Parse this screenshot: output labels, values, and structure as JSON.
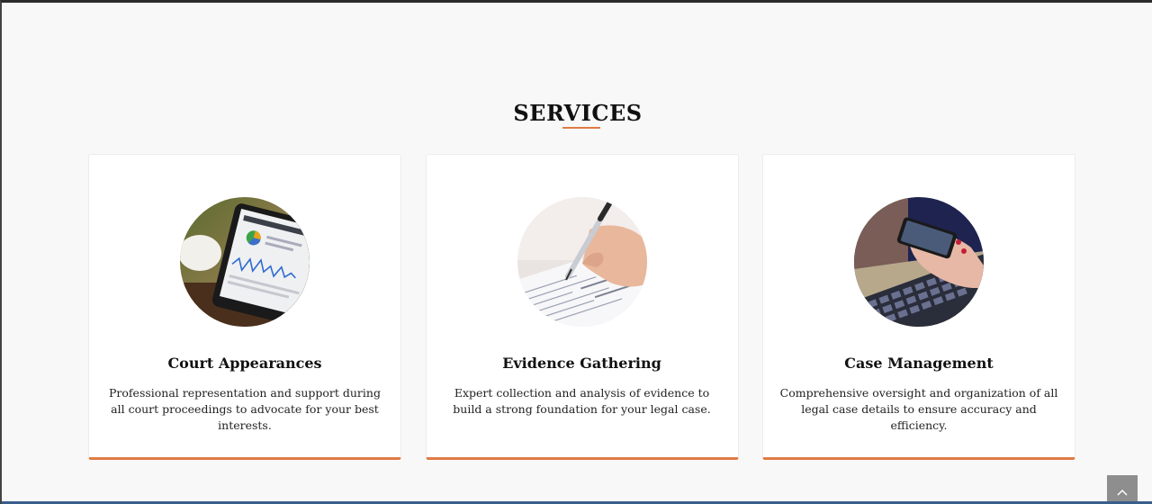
{
  "section": {
    "title": "SERVICES"
  },
  "cards": [
    {
      "title": "Court Appearances",
      "description": "Professional representation and support during all court proceedings to advocate for your best interests.",
      "image_icon": "tablet-analytics-photo"
    },
    {
      "title": "Evidence Gathering",
      "description": "Expert collection and analysis of evidence to build a strong foundation for your legal case.",
      "image_icon": "hand-signing-document-photo"
    },
    {
      "title": "Case Management",
      "description": "Comprehensive oversight and organization of all legal case details to ensure accuracy and efficiency.",
      "image_icon": "phone-and-laptop-photo"
    }
  ],
  "scroll_top": {
    "icon": "chevron-up-icon"
  },
  "colors": {
    "accent": "#e07b45",
    "background": "#f8f8f8",
    "card": "#ffffff",
    "scroll_button": "#8e8e8e"
  }
}
